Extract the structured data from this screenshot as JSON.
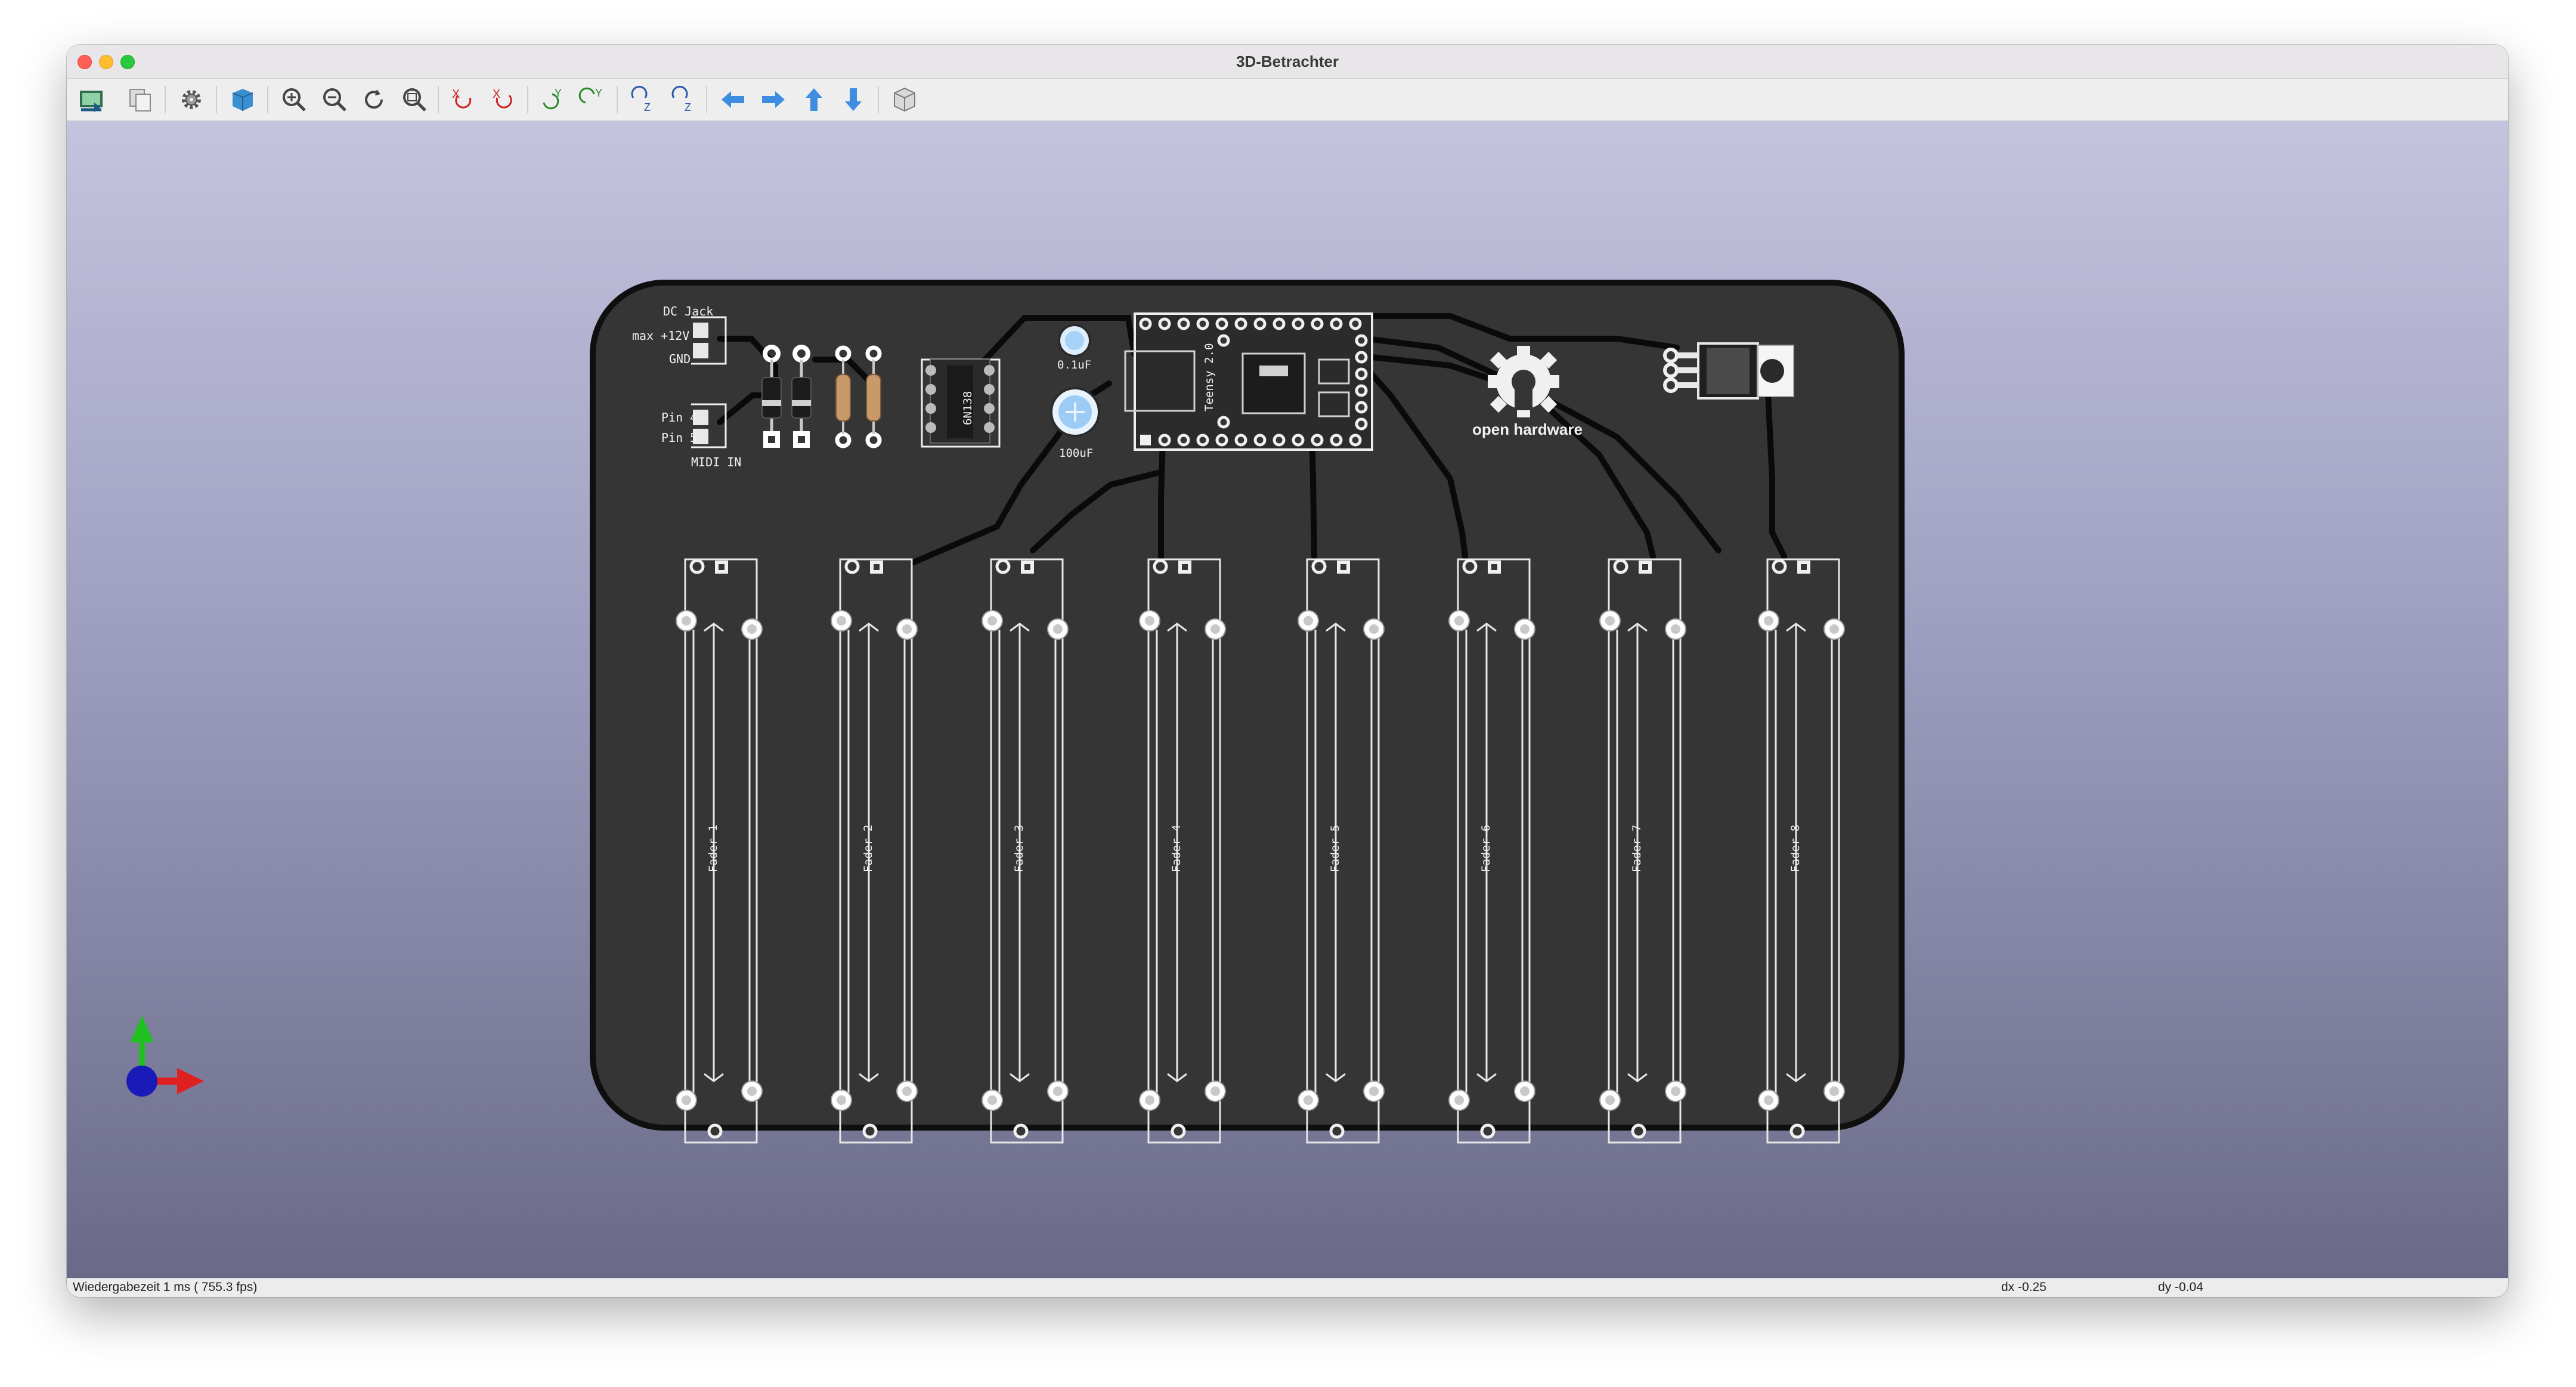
{
  "window": {
    "title": "3D-Betrachter"
  },
  "toolbar": {
    "buttons": [
      {
        "name": "reload-board-icon",
        "tooltip": "Reload board"
      },
      {
        "name": "copy-3d-image-icon",
        "tooltip": "Copy 3D image"
      },
      {
        "name": "preferences-icon",
        "tooltip": "Preferences"
      },
      {
        "name": "raytracing-icon",
        "tooltip": "Render options"
      },
      {
        "name": "zoom-in-icon",
        "tooltip": "Zoom in"
      },
      {
        "name": "zoom-out-icon",
        "tooltip": "Zoom out"
      },
      {
        "name": "redraw-icon",
        "tooltip": "Redraw"
      },
      {
        "name": "zoom-fit-icon",
        "tooltip": "Zoom to fit"
      },
      {
        "name": "rotate-x-cw-icon",
        "label": "X"
      },
      {
        "name": "rotate-x-ccw-icon",
        "label": "X"
      },
      {
        "name": "rotate-y-cw-icon",
        "label": "Y"
      },
      {
        "name": "rotate-y-ccw-icon",
        "label": "Y"
      },
      {
        "name": "rotate-z-cw-icon",
        "label": "Z"
      },
      {
        "name": "rotate-z-ccw-icon",
        "label": "Z"
      },
      {
        "name": "move-left-icon"
      },
      {
        "name": "move-right-icon"
      },
      {
        "name": "move-up-icon"
      },
      {
        "name": "move-down-icon"
      },
      {
        "name": "orthographic-icon"
      }
    ]
  },
  "board": {
    "silkscreen": {
      "dc_jack": "DC Jack",
      "max_12v": "max +12V",
      "gnd": "GND",
      "pin4": "Pin 4",
      "pin5": "Pin 5",
      "midi_in": "MIDI IN",
      "cap_small": "0.1uF",
      "cap_large": "100uF",
      "optocoupler": "6N138",
      "teensy": "Teensy 2.0",
      "logo": "open hardware"
    },
    "faders": [
      "Fader 1",
      "Fader 2",
      "Fader 3",
      "Fader 4",
      "Fader 5",
      "Fader 6",
      "Fader 7",
      "Fader 8"
    ]
  },
  "colors": {
    "board": "#353535",
    "edge": "#111111",
    "silk": "#f0f0f0",
    "trace": "#0a0a0a",
    "pad": "#e8e8e8",
    "viewport_top": "#c4c4df",
    "viewport_bottom": "#6a6a88"
  },
  "status": {
    "render_time": "Wiedergabezeit 1 ms ( 755.3 fps)",
    "dx": "dx -0.25",
    "dy": "dy -0.04"
  }
}
